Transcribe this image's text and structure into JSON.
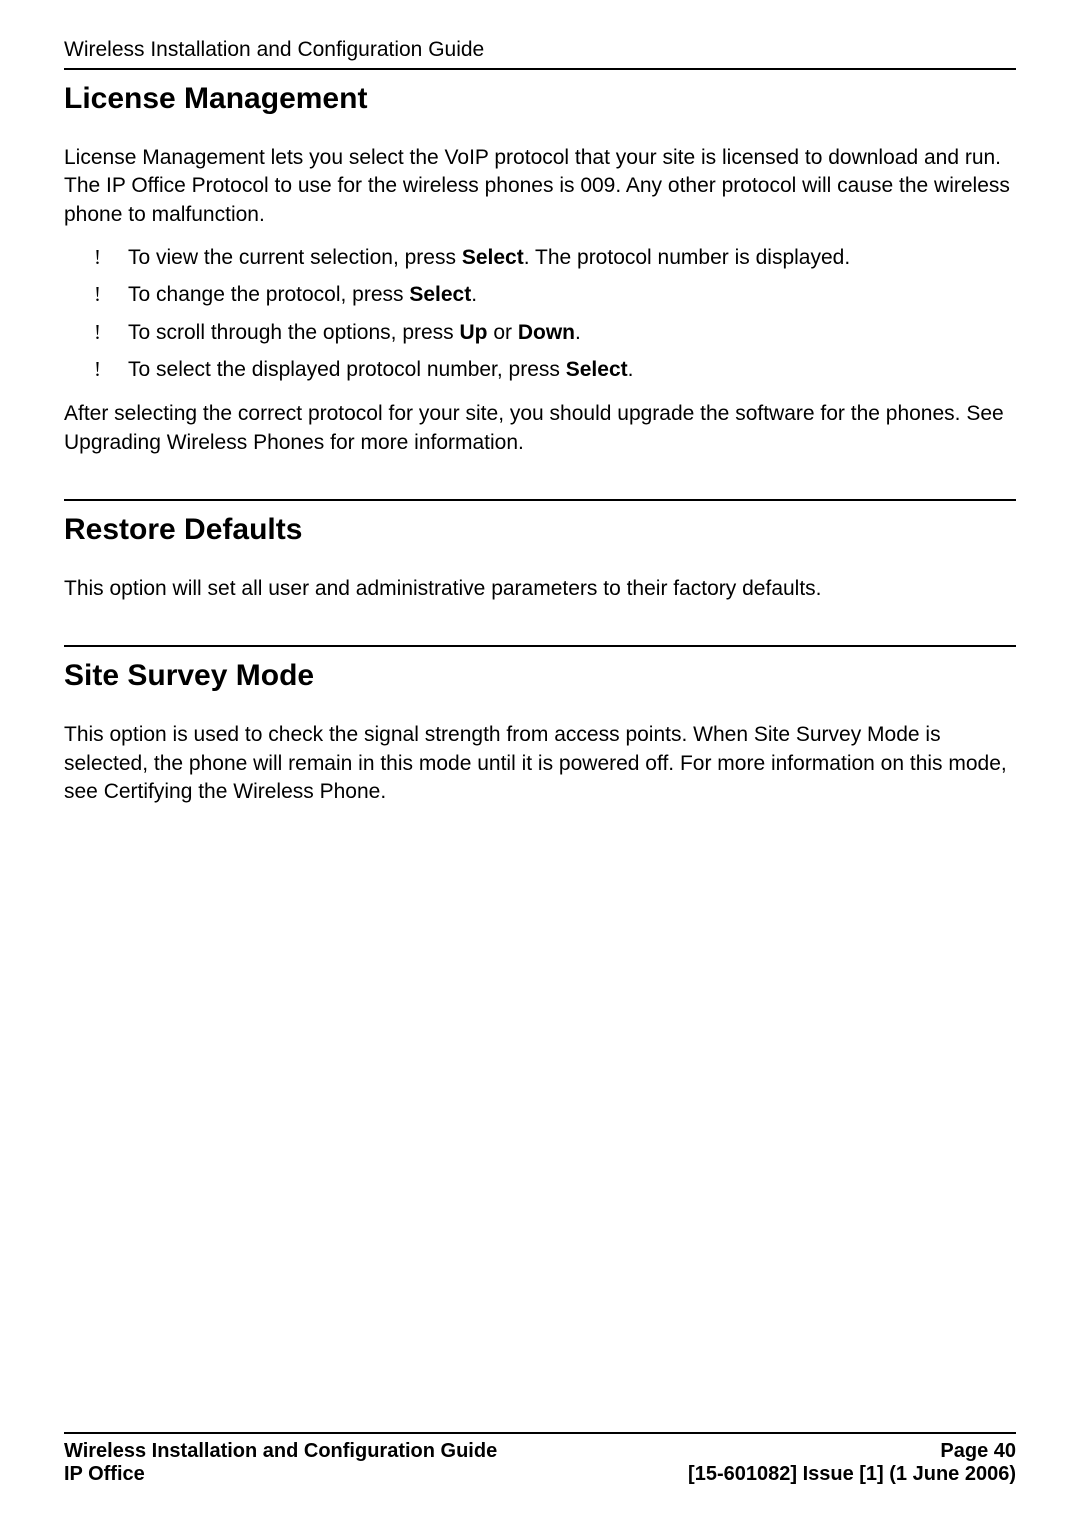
{
  "header": {
    "title": "Wireless Installation and Configuration Guide"
  },
  "sections": {
    "s1": {
      "heading": "License Management",
      "intro": "License Management lets you select the VoIP protocol that your site is licensed to download and run. The IP Office Protocol to use for the wireless phones is 009. Any other protocol will cause the wireless phone to malfunction.",
      "bullets": {
        "b0_pre": "To view the current selection, press ",
        "b0_bold": "Select",
        "b0_post": ". The protocol number is displayed.",
        "b1_pre": "To change the protocol, press ",
        "b1_bold": "Select",
        "b1_post": ".",
        "b2_pre": "To scroll through the options, press ",
        "b2_bold1": "Up",
        "b2_mid": " or ",
        "b2_bold2": "Down",
        "b2_post": ".",
        "b3_pre": "To select the displayed protocol number, press ",
        "b3_bold": "Select",
        "b3_post": "."
      },
      "outro": "After selecting the correct protocol for your site, you should upgrade the software for the phones. See Upgrading Wireless Phones for more information."
    },
    "s2": {
      "heading": "Restore Defaults",
      "body": "This option will set all user and administrative parameters to their factory defaults."
    },
    "s3": {
      "heading": "Site Survey Mode",
      "body": "This option is used to check the signal strength from access points. When Site Survey Mode is selected, the phone will remain in this mode until it is powered off. For more information on this mode, see Certifying the Wireless Phone."
    }
  },
  "footer": {
    "left1": "Wireless Installation and Configuration Guide",
    "right1": "Page 40",
    "left2": "IP Office",
    "right2": "[15-601082] Issue [1] (1 June 2006)"
  },
  "bullet_char": "!"
}
